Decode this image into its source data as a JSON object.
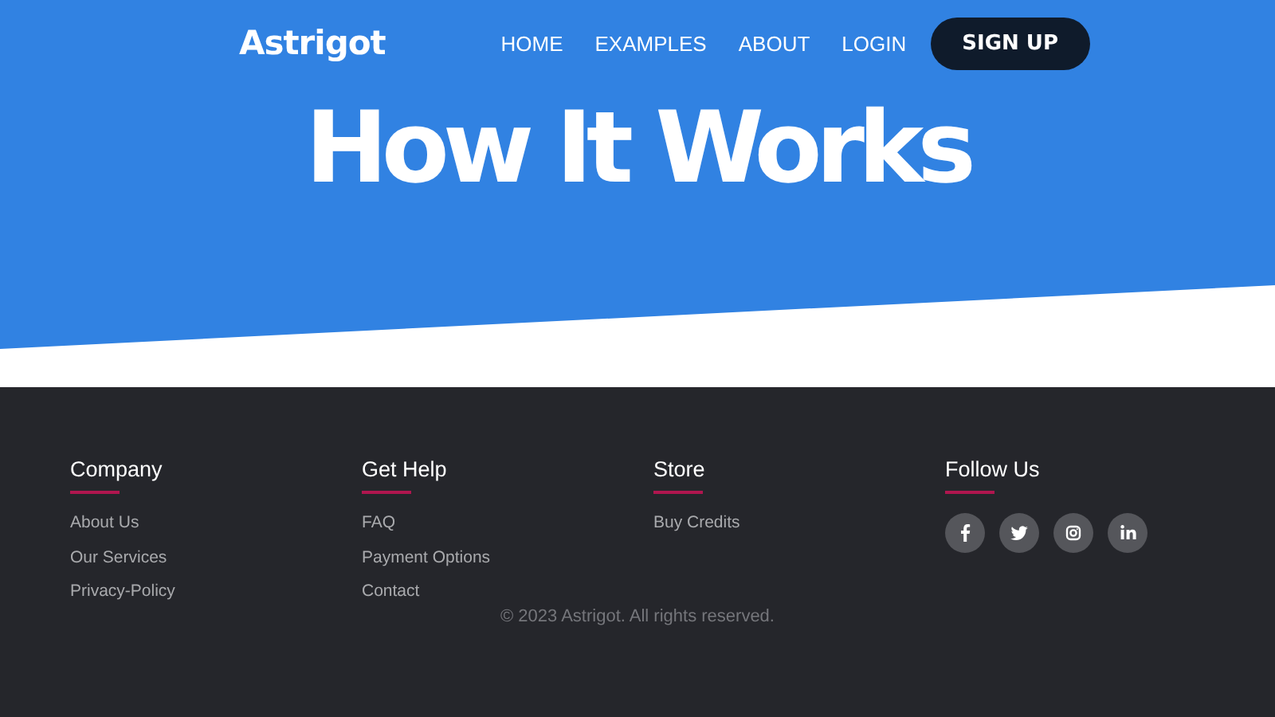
{
  "header": {
    "logo": "Astrigot",
    "nav": [
      "HOME",
      "EXAMPLES",
      "ABOUT",
      "LOGIN"
    ],
    "cta": "SIGN UP"
  },
  "hero": {
    "title": "How It Works"
  },
  "footer": {
    "columns": [
      {
        "heading": "Company",
        "links": [
          "About Us",
          "Our Services",
          "Privacy-Policy"
        ]
      },
      {
        "heading": "Get Help",
        "links": [
          "FAQ",
          "Payment Options",
          "Contact"
        ]
      },
      {
        "heading": "Store",
        "links": [
          "Buy Credits"
        ]
      },
      {
        "heading": "Follow Us",
        "social": [
          {
            "kind": "facebook"
          },
          {
            "kind": "twitter"
          },
          {
            "kind": "instagram"
          },
          {
            "kind": "linkedin"
          }
        ]
      }
    ],
    "copyright": "© 2023 Astrigot. All rights reserved."
  }
}
